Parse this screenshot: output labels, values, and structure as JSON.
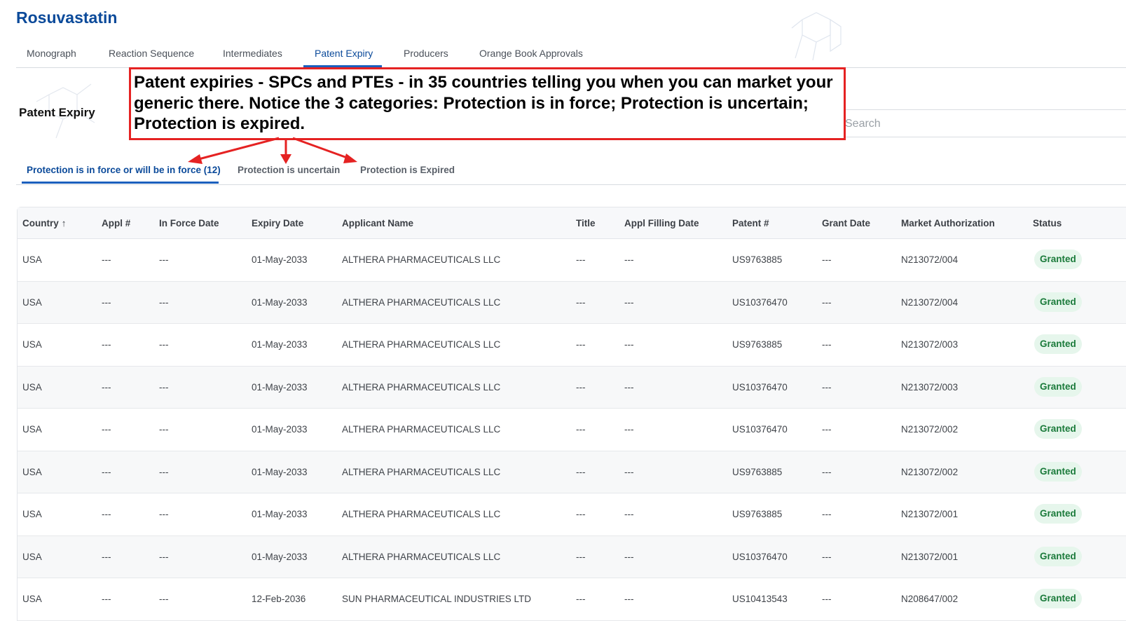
{
  "app": {
    "title": "Rosuvastatin"
  },
  "top_tabs": [
    "Monograph",
    "Reaction Sequence",
    "Intermediates",
    "Patent Expiry",
    "Producers",
    "Orange Book Approvals"
  ],
  "active_top_tab": "Patent Expiry",
  "section": {
    "title": "Patent Expiry"
  },
  "search": {
    "placeholder": "Search"
  },
  "annotation": {
    "text": "Patent expiries - SPCs and PTEs - in 35 countries telling you when you can market your generic there. Notice the 3 categories: Protection is in force; Protection is uncertain; Protection is expired."
  },
  "sub_tabs": [
    "Protection is in force or will be in force (12)",
    "Protection is uncertain",
    "Protection is Expired"
  ],
  "active_sub_tab": "Protection is in force or will be in force (12)",
  "colors": {
    "brand": "#0b4a9a",
    "accent": "#1b5fbd",
    "annotation": "#e52222",
    "granted_bg": "#e6f6ec",
    "granted_text": "#1a7a3a"
  },
  "table": {
    "columns": [
      "Country",
      "Appl #",
      "In Force Date",
      "Expiry Date",
      "Applicant Name",
      "Title",
      "Appl Filling Date",
      "Patent #",
      "Grant Date",
      "Market Authorization",
      "Status"
    ],
    "sort_icon": "arrow-up-icon",
    "rows": [
      [
        "USA",
        "---",
        "---",
        "01-May-2033",
        "ALTHERA PHARMACEUTICALS LLC",
        "---",
        "---",
        "US9763885",
        "---",
        "N213072/004",
        "Granted"
      ],
      [
        "USA",
        "---",
        "---",
        "01-May-2033",
        "ALTHERA PHARMACEUTICALS LLC",
        "---",
        "---",
        "US10376470",
        "---",
        "N213072/004",
        "Granted"
      ],
      [
        "USA",
        "---",
        "---",
        "01-May-2033",
        "ALTHERA PHARMACEUTICALS LLC",
        "---",
        "---",
        "US9763885",
        "---",
        "N213072/003",
        "Granted"
      ],
      [
        "USA",
        "---",
        "---",
        "01-May-2033",
        "ALTHERA PHARMACEUTICALS LLC",
        "---",
        "---",
        "US10376470",
        "---",
        "N213072/003",
        "Granted"
      ],
      [
        "USA",
        "---",
        "---",
        "01-May-2033",
        "ALTHERA PHARMACEUTICALS LLC",
        "---",
        "---",
        "US10376470",
        "---",
        "N213072/002",
        "Granted"
      ],
      [
        "USA",
        "---",
        "---",
        "01-May-2033",
        "ALTHERA PHARMACEUTICALS LLC",
        "---",
        "---",
        "US9763885",
        "---",
        "N213072/002",
        "Granted"
      ],
      [
        "USA",
        "---",
        "---",
        "01-May-2033",
        "ALTHERA PHARMACEUTICALS LLC",
        "---",
        "---",
        "US9763885",
        "---",
        "N213072/001",
        "Granted"
      ],
      [
        "USA",
        "---",
        "---",
        "01-May-2033",
        "ALTHERA PHARMACEUTICALS LLC",
        "---",
        "---",
        "US10376470",
        "---",
        "N213072/001",
        "Granted"
      ],
      [
        "USA",
        "---",
        "---",
        "12-Feb-2036",
        "SUN PHARMACEUTICAL INDUSTRIES LTD",
        "---",
        "---",
        "US10413543",
        "---",
        "N208647/002",
        "Granted"
      ]
    ]
  }
}
